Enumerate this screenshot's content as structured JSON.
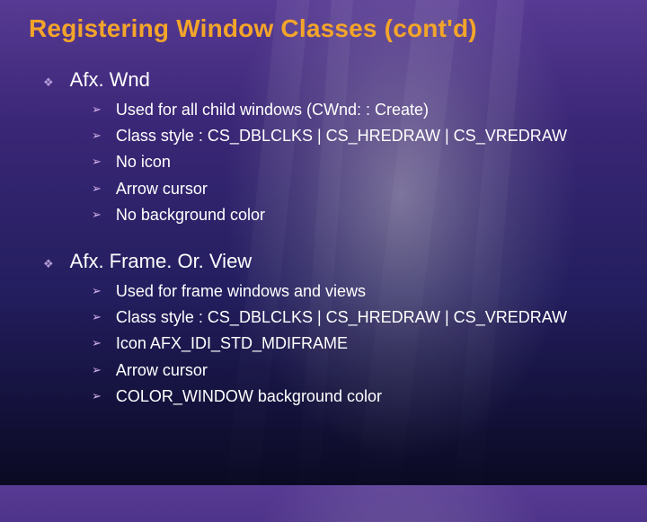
{
  "title": "Registering Window Classes (cont'd)",
  "sections": [
    {
      "heading": "Afx. Wnd",
      "items": [
        "Used for all child windows (CWnd: : Create)",
        "Class style : CS_DBLCLKS | CS_HREDRAW | CS_VREDRAW",
        "No icon",
        "Arrow cursor",
        "No background color"
      ]
    },
    {
      "heading": "Afx. Frame. Or. View",
      "items": [
        "Used for frame windows and views",
        "Class style : CS_DBLCLKS | CS_HREDRAW | CS_VREDRAW",
        "Icon AFX_IDI_STD_MDIFRAME",
        "Arrow cursor",
        "COLOR_WINDOW background color"
      ]
    }
  ],
  "bullets": {
    "diamond": "❖",
    "chevron": "➢"
  }
}
